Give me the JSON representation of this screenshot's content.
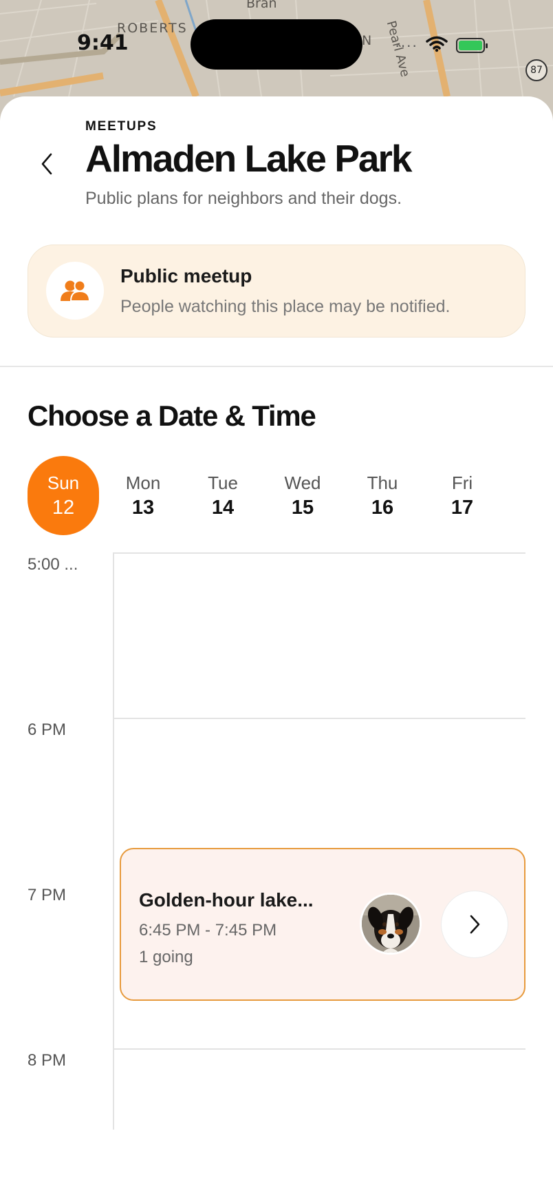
{
  "status_bar": {
    "time": "9:41",
    "route_shield": "87"
  },
  "map": {
    "labels": {
      "roberts": "ROBERTS",
      "bran": "Bran",
      "n": "N",
      "pearl": "Pearl Ave"
    }
  },
  "header": {
    "eyebrow": "MEETUPS",
    "title": "Almaden Lake Park",
    "subtitle": "Public plans for neighbors and their dogs."
  },
  "notice": {
    "icon": "people-icon",
    "title": "Public meetup",
    "text": "People watching this place may be notified."
  },
  "schedule": {
    "title": "Choose a Date & Time",
    "days": [
      {
        "name": "Sun",
        "num": "12",
        "selected": true
      },
      {
        "name": "Mon",
        "num": "13",
        "selected": false
      },
      {
        "name": "Tue",
        "num": "14",
        "selected": false
      },
      {
        "name": "Wed",
        "num": "15",
        "selected": false
      },
      {
        "name": "Thu",
        "num": "16",
        "selected": false
      },
      {
        "name": "Fri",
        "num": "17",
        "selected": false
      }
    ],
    "time_labels": [
      "5:00 ...",
      "6 PM",
      "7 PM",
      "8 PM"
    ],
    "event": {
      "title": "Golden-hour lake...",
      "time": "6:45 PM - 7:45 PM",
      "attendees": "1 going",
      "avatar": "dog-avatar"
    }
  },
  "colors": {
    "accent": "#fa7a0d",
    "notice_bg": "#fdf2e3",
    "event_bg": "#fdf2ee",
    "event_border": "#e79a3c"
  }
}
